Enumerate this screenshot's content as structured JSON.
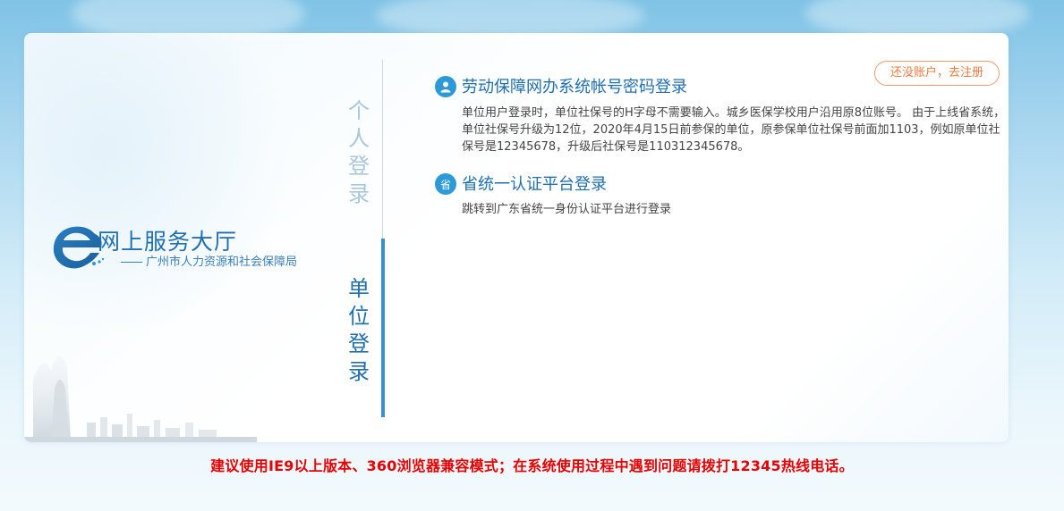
{
  "brand": {
    "title": "网上服务大厅",
    "subtitle": "广州市人力资源和社会保障局"
  },
  "tabs": {
    "personal": [
      "个",
      "人",
      "登",
      "录"
    ],
    "unit": [
      "单",
      "位",
      "登",
      "录"
    ]
  },
  "register": {
    "label": "还没账户，去注册"
  },
  "options": {
    "password": {
      "icon": "user-icon",
      "title": "劳动保障网办系统帐号密码登录",
      "desc": "单位用户登录时，单位社保号的H字母不需要输入。城乡医保学校用户沿用原8位账号。 由于上线省系统，单位社保号升级为12位，2020年4月15日前参保的单位，原参保单位社保号前面加1103，例如原单位社保号是12345678，升级后社保号是110312345678。"
    },
    "province": {
      "icon_text": "省",
      "title": "省统一认证平台登录",
      "desc": "跳转到广东省统一身份认证平台进行登录"
    }
  },
  "notice": "建议使用IE9以上版本、360浏览器兼容模式；在系统使用过程中遇到问题请拨打12345热线电话。",
  "colors": {
    "accent": "#1f6fb3",
    "register": "#ec7a41",
    "notice": "#e60000"
  }
}
